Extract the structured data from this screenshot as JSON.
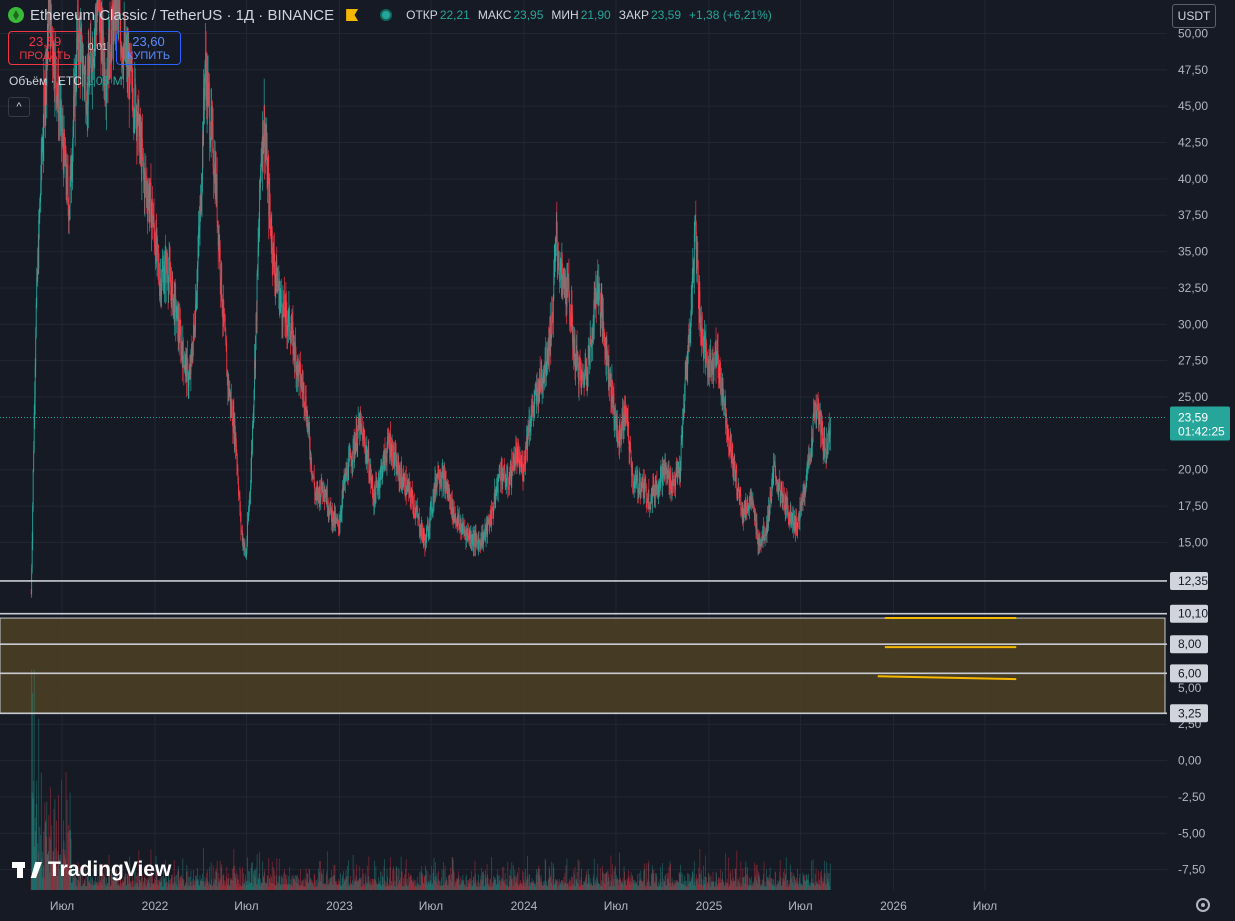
{
  "header": {
    "symbol": "Ethereum Classic / TetherUS · 1Д · BINANCE",
    "ohlc": [
      {
        "label": "ОТКР",
        "value": "22,21"
      },
      {
        "label": "МАКС",
        "value": "23,95"
      },
      {
        "label": "МИН",
        "value": "21,90"
      },
      {
        "label": "ЗАКР",
        "value": "23,59"
      },
      {
        "label": "",
        "value": "+1,38 (+6,21%)"
      }
    ]
  },
  "trade": {
    "sell_price": "23,59",
    "sell_label": "ПРОДАТЬ",
    "spread": "0,01",
    "buy_price": "23,60",
    "buy_label": "КУПИТЬ"
  },
  "volume_legend": {
    "label": "Объём · ETC",
    "value": "1,05 M"
  },
  "collapse_label": "^",
  "currency": "USDT",
  "watermark": "TradingView",
  "colors": {
    "background": "#161a25",
    "grid": "#232632",
    "up": "#26a69a",
    "down": "#f23645",
    "zone": "#4d4224",
    "level_line": "#c9cbd2",
    "drawing": "#f5b800"
  },
  "chart_data": {
    "type": "candlestick",
    "y_axis": {
      "ylim": [
        -8.9,
        52.3
      ],
      "ticks": [
        "50,00",
        "47,50",
        "45,00",
        "42,50",
        "40,00",
        "37,50",
        "35,00",
        "32,50",
        "30,00",
        "27,50",
        "25,00",
        "20,00",
        "17,50",
        "15,00",
        "5,00",
        "2,50",
        "0,00",
        "-2,50",
        "-5,00",
        "-7,50"
      ],
      "tick_values": [
        50,
        47.5,
        45,
        42.5,
        40,
        37.5,
        35,
        32.5,
        30,
        27.5,
        25,
        20,
        17.5,
        15,
        5,
        2.5,
        0,
        -2.5,
        -5,
        -7.5
      ]
    },
    "x_axis": {
      "labels": [
        "Июл",
        "2022",
        "Июл",
        "2023",
        "Июл",
        "2024",
        "Июл",
        "2025",
        "Июл",
        "2026",
        "Июл"
      ],
      "dates": [
        "2021-07-01",
        "2022-01-01",
        "2022-07-01",
        "2023-01-01",
        "2023-07-01",
        "2024-01-01",
        "2024-07-01",
        "2025-01-01",
        "2025-07-01",
        "2026-01-01",
        "2026-07-01"
      ]
    },
    "last_price": {
      "value": 23.59,
      "label": "23,59",
      "countdown": "01:42:25"
    },
    "horizontal_levels": [
      {
        "value": 12.35,
        "label": "12,35"
      },
      {
        "value": 10.1,
        "label": "10,10"
      },
      {
        "value": 8.0,
        "label": "8,00"
      },
      {
        "value": 6.0,
        "label": "6,00"
      },
      {
        "value": 3.25,
        "label": "3,25"
      }
    ],
    "zone": {
      "from": 3.25,
      "to": 9.8
    },
    "drawn_lines": [
      {
        "from": "2025-12-15",
        "to": "2026-09-01",
        "y1": 9.8,
        "y2": 9.8
      },
      {
        "from": "2025-12-15",
        "to": "2026-09-01",
        "y1": 7.8,
        "y2": 7.8
      },
      {
        "from": "2025-12-01",
        "to": "2026-09-01",
        "y1": 5.8,
        "y2": 5.6
      }
    ],
    "price_path": [
      [
        "2021-05-01",
        11.5
      ],
      [
        "2021-05-10",
        30
      ],
      [
        "2021-05-20",
        40
      ],
      [
        "2021-06-05",
        52
      ],
      [
        "2021-06-25",
        45
      ],
      [
        "2021-07-15",
        38
      ],
      [
        "2021-08-01",
        50
      ],
      [
        "2021-08-20",
        46
      ],
      [
        "2021-09-10",
        52
      ],
      [
        "2021-09-25",
        47
      ],
      [
        "2021-10-15",
        52
      ],
      [
        "2021-11-05",
        48
      ],
      [
        "2021-11-25",
        45
      ],
      [
        "2021-12-10",
        40
      ],
      [
        "2021-12-25",
        38
      ],
      [
        "2022-01-10",
        33
      ],
      [
        "2022-01-25",
        34
      ],
      [
        "2022-02-10",
        31
      ],
      [
        "2022-02-25",
        28
      ],
      [
        "2022-03-10",
        26
      ],
      [
        "2022-03-20",
        30
      ],
      [
        "2022-04-01",
        38
      ],
      [
        "2022-04-10",
        48
      ],
      [
        "2022-04-20",
        44
      ],
      [
        "2022-05-01",
        40
      ],
      [
        "2022-05-15",
        31
      ],
      [
        "2022-05-25",
        26
      ],
      [
        "2022-06-10",
        22
      ],
      [
        "2022-06-20",
        16
      ],
      [
        "2022-06-30",
        14
      ],
      [
        "2022-07-10",
        20
      ],
      [
        "2022-07-20",
        30
      ],
      [
        "2022-07-30",
        42
      ],
      [
        "2022-08-05",
        44
      ],
      [
        "2022-08-15",
        38
      ],
      [
        "2022-08-25",
        34
      ],
      [
        "2022-09-10",
        31
      ],
      [
        "2022-09-25",
        30
      ],
      [
        "2022-10-10",
        27
      ],
      [
        "2022-10-25",
        25
      ],
      [
        "2022-11-05",
        21
      ],
      [
        "2022-11-15",
        18
      ],
      [
        "2022-11-30",
        19
      ],
      [
        "2022-12-15",
        17
      ],
      [
        "2022-12-30",
        16
      ],
      [
        "2023-01-10",
        19
      ],
      [
        "2023-01-25",
        21
      ],
      [
        "2023-02-10",
        23
      ],
      [
        "2023-02-25",
        21
      ],
      [
        "2023-03-10",
        18
      ],
      [
        "2023-03-25",
        20
      ],
      [
        "2023-04-10",
        22
      ],
      [
        "2023-04-25",
        20
      ],
      [
        "2023-05-10",
        19
      ],
      [
        "2023-05-25",
        18
      ],
      [
        "2023-06-10",
        16
      ],
      [
        "2023-06-20",
        15
      ],
      [
        "2023-06-30",
        17
      ],
      [
        "2023-07-15",
        20
      ],
      [
        "2023-07-30",
        19
      ],
      [
        "2023-08-15",
        17
      ],
      [
        "2023-08-30",
        16
      ],
      [
        "2023-09-15",
        15.5
      ],
      [
        "2023-09-30",
        15
      ],
      [
        "2023-10-15",
        15.5
      ],
      [
        "2023-10-30",
        17
      ],
      [
        "2023-11-15",
        20
      ],
      [
        "2023-11-30",
        19
      ],
      [
        "2023-12-15",
        21
      ],
      [
        "2023-12-30",
        20
      ],
      [
        "2024-01-10",
        23
      ],
      [
        "2024-01-25",
        25
      ],
      [
        "2024-02-10",
        27
      ],
      [
        "2024-02-25",
        30
      ],
      [
        "2024-03-05",
        36
      ],
      [
        "2024-03-15",
        33
      ],
      [
        "2024-03-30",
        32
      ],
      [
        "2024-04-10",
        28
      ],
      [
        "2024-04-25",
        26
      ],
      [
        "2024-05-10",
        28
      ],
      [
        "2024-05-25",
        33
      ],
      [
        "2024-06-05",
        30
      ],
      [
        "2024-06-20",
        26
      ],
      [
        "2024-07-05",
        22
      ],
      [
        "2024-07-20",
        24
      ],
      [
        "2024-08-05",
        19
      ],
      [
        "2024-08-20",
        19
      ],
      [
        "2024-09-05",
        18
      ],
      [
        "2024-09-20",
        19
      ],
      [
        "2024-10-05",
        20
      ],
      [
        "2024-10-20",
        19
      ],
      [
        "2024-11-05",
        20
      ],
      [
        "2024-11-15",
        26
      ],
      [
        "2024-11-25",
        30
      ],
      [
        "2024-12-05",
        37
      ],
      [
        "2024-12-15",
        30
      ],
      [
        "2024-12-30",
        27
      ],
      [
        "2025-01-15",
        28
      ],
      [
        "2025-01-30",
        25
      ],
      [
        "2025-02-10",
        22
      ],
      [
        "2025-02-25",
        19
      ],
      [
        "2025-03-10",
        17
      ],
      [
        "2025-03-25",
        18
      ],
      [
        "2025-04-10",
        15
      ],
      [
        "2025-04-25",
        16
      ],
      [
        "2025-05-10",
        20
      ],
      [
        "2025-05-25",
        18
      ],
      [
        "2025-06-10",
        17
      ],
      [
        "2025-06-25",
        16
      ],
      [
        "2025-07-10",
        19
      ],
      [
        "2025-07-20",
        21
      ],
      [
        "2025-07-30",
        24.5
      ],
      [
        "2025-08-10",
        23
      ],
      [
        "2025-08-20",
        21
      ],
      [
        "2025-08-30",
        23.59
      ]
    ]
  }
}
